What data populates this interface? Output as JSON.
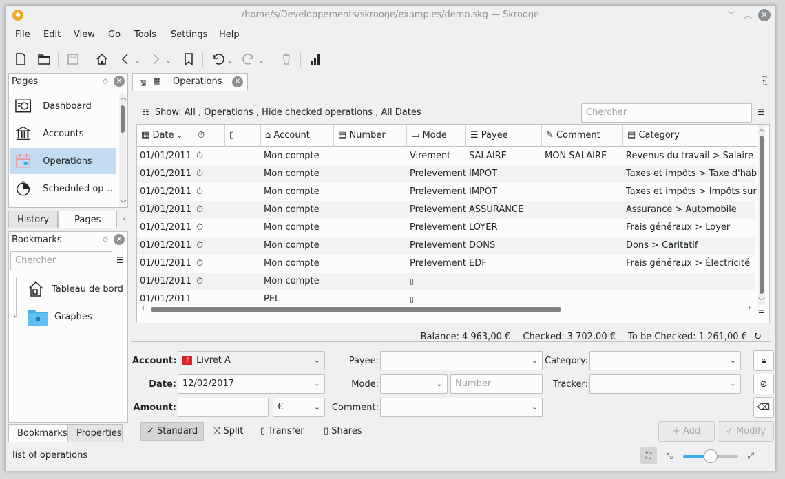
{
  "window": {
    "title": "/home/s/Developpements/skrooge/examples/demo.skg — Skrooge",
    "minimize_glyph": "﹀",
    "maximize_glyph": "︿",
    "close_glyph": "✕"
  },
  "menu": [
    "File",
    "Edit",
    "View",
    "Go",
    "Tools",
    "Settings",
    "Help"
  ],
  "pages_dock": {
    "title": "Pages",
    "items": [
      {
        "label": "Dashboard",
        "icon": "dashboard-icon"
      },
      {
        "label": "Accounts",
        "icon": "bank-icon"
      },
      {
        "label": "Operations",
        "icon": "operations-icon",
        "selected": true
      },
      {
        "label": "Scheduled oper...",
        "icon": "scheduled-icon"
      }
    ],
    "tabs": [
      "History",
      "Pages"
    ]
  },
  "bookmarks_dock": {
    "title": "Bookmarks",
    "search_placeholder": "Chercher",
    "items": [
      {
        "label": "Tableau de bord",
        "icon": "house-icon"
      },
      {
        "label": "Graphes",
        "icon": "folder-icon"
      }
    ],
    "tabs": [
      "Bookmarks",
      "Properties"
    ]
  },
  "main_tab": {
    "label": "Operations"
  },
  "filter_text": "Show: All , Operations , Hide checked operations , All Dates",
  "search_placeholder": "Chercher",
  "table": {
    "headers": [
      "Date",
      "",
      "",
      "Account",
      "Number",
      "Mode",
      "Payee",
      "Comment",
      "Category"
    ],
    "rows": [
      {
        "date": "01/01/2011",
        "sched": true,
        "account": "Mon compte",
        "number": "",
        "mode": "Virement",
        "payee": "SALAIRE",
        "comment": "MON SALAIRE",
        "category": "Revenus du travail > Salaire net"
      },
      {
        "date": "01/01/2011",
        "sched": true,
        "account": "Mon compte",
        "number": "",
        "mode": "Prelevement",
        "payee": "IMPOT",
        "comment": "",
        "category": "Taxes et impôts > Taxe d'habita"
      },
      {
        "date": "01/01/2011",
        "sched": true,
        "account": "Mon compte",
        "number": "",
        "mode": "Prelevement",
        "payee": "IMPOT",
        "comment": "",
        "category": "Taxes et impôts > Impôts sur le"
      },
      {
        "date": "01/01/2011",
        "sched": true,
        "account": "Mon compte",
        "number": "",
        "mode": "Prelevement",
        "payee": "ASSURANCE",
        "comment": "",
        "category": "Assurance > Automobile"
      },
      {
        "date": "01/01/2011",
        "sched": true,
        "account": "Mon compte",
        "number": "",
        "mode": "Prelevement",
        "payee": "LOYER",
        "comment": "",
        "category": "Frais généraux > Loyer"
      },
      {
        "date": "01/01/2011",
        "sched": true,
        "account": "Mon compte",
        "number": "",
        "mode": "Prelevement",
        "payee": "DONS",
        "comment": "",
        "category": "Dons > Caritatif"
      },
      {
        "date": "01/01/2011",
        "sched": true,
        "account": "Mon compte",
        "number": "",
        "mode": "Prelevement",
        "payee": "EDF",
        "comment": "",
        "category": "Frais généraux > Électricité"
      },
      {
        "date": "01/01/2011",
        "sched": true,
        "account": "Mon compte",
        "number": "",
        "mode": "",
        "payee": "",
        "comment": "",
        "category": ""
      },
      {
        "date": "01/01/2011",
        "sched": false,
        "account": "PEL",
        "number": "",
        "mode": "",
        "payee": "",
        "comment": "",
        "category": ""
      }
    ]
  },
  "balance": {
    "balance": "Balance: 4 963,00 €",
    "checked": "Checked: 3 702,00 €",
    "to_be_checked": "To be Checked: 1 261,00 €"
  },
  "form": {
    "account_label": "Account:",
    "account_value": "Livret A",
    "date_label": "Date:",
    "date_value": "12/02/2017",
    "amount_label": "Amount:",
    "currency": "€",
    "payee_label": "Payee:",
    "mode_label": "Mode:",
    "number_placeholder": "Number",
    "comment_label": "Comment:",
    "category_label": "Category:",
    "tracker_label": "Tracker:",
    "modes": [
      "Standard",
      "Split",
      "Transfer",
      "Shares"
    ],
    "add_label": "Add",
    "modify_label": "Modify"
  },
  "status": {
    "text": "list of operations",
    "zoom_fraction": 0.5
  },
  "colors": {
    "selection": "#c3dcf2",
    "accent": "#3daee9",
    "app_icon": "#f4a62a"
  }
}
